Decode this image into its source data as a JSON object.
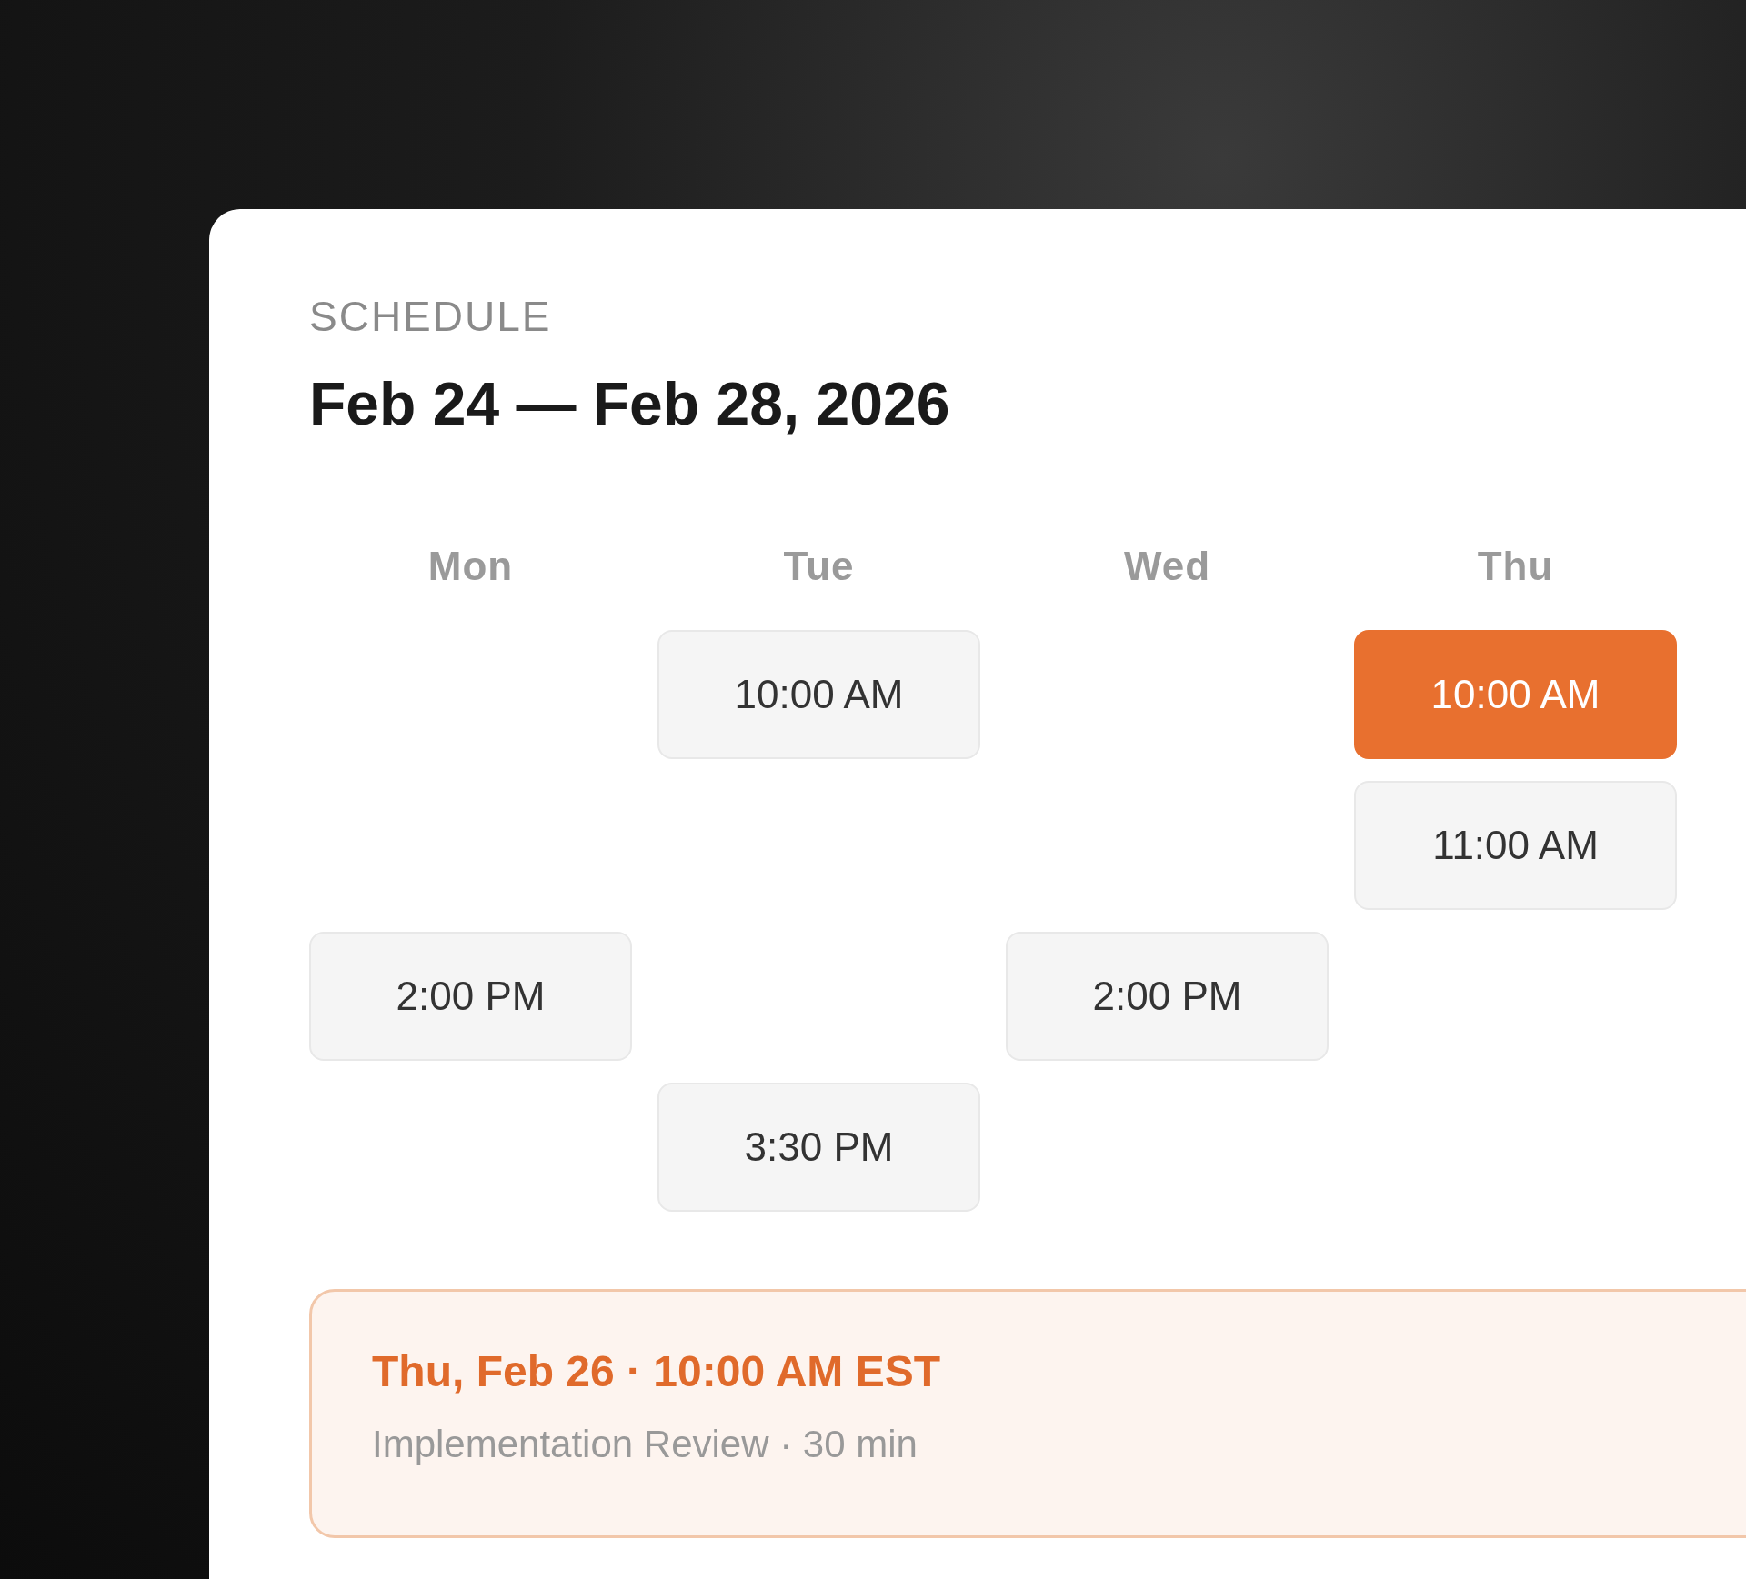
{
  "schedule": {
    "eyebrow": "SCHEDULE",
    "range": "Feb 24 — Feb 28, 2026",
    "days": [
      "Mon",
      "Tue",
      "Wed",
      "Thu"
    ],
    "rows": [
      {
        "cells": [
          null,
          {
            "time": "10:00 AM",
            "selected": false
          },
          null,
          {
            "time": "10:00 AM",
            "selected": true
          }
        ]
      },
      {
        "cells": [
          null,
          null,
          null,
          {
            "time": "11:00 AM",
            "selected": false
          }
        ]
      },
      {
        "cells": [
          {
            "time": "2:00 PM",
            "selected": false
          },
          null,
          {
            "time": "2:00 PM",
            "selected": false
          },
          null
        ]
      },
      {
        "cells": [
          null,
          {
            "time": "3:30 PM",
            "selected": false
          },
          null,
          null
        ]
      }
    ],
    "confirmation": {
      "heading": "Thu, Feb 26 · 10:00 AM EST",
      "detail": "Implementation Review · 30 min"
    }
  }
}
